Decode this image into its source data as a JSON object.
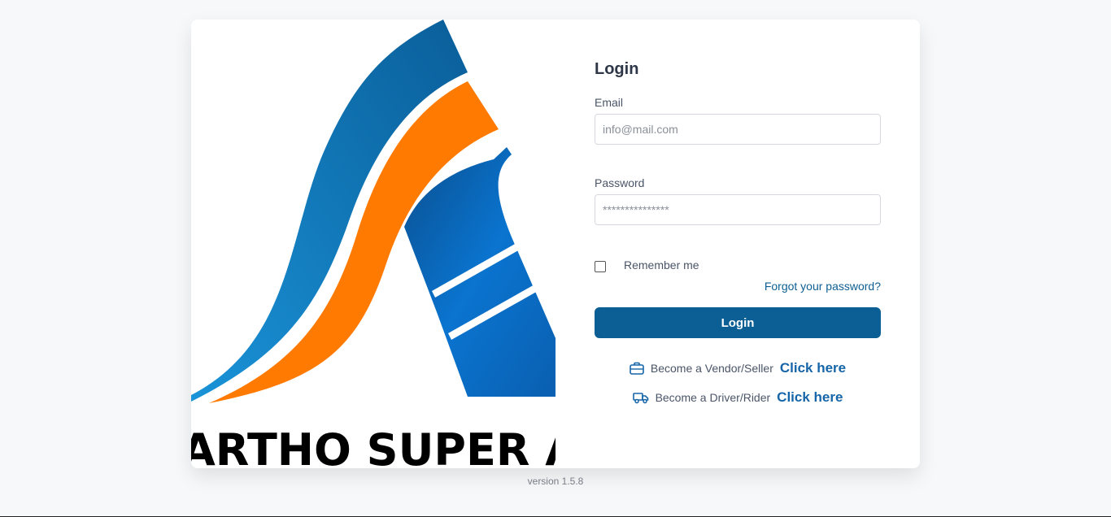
{
  "logo": {
    "wordmark": "ARTHO SUPER APP",
    "colors": {
      "blue_light": "#1485d0",
      "blue_dark": "#0a5a97",
      "orange": "#ff7a00"
    }
  },
  "login": {
    "title": "Login",
    "email": {
      "label": "Email",
      "placeholder": "info@mail.com",
      "value": ""
    },
    "password": {
      "label": "Password",
      "placeholder": "***************",
      "value": ""
    },
    "remember_label": "Remember me",
    "remember_checked": false,
    "forgot_label": "Forgot your password?",
    "submit_label": "Login"
  },
  "cta": [
    {
      "icon": "briefcase-icon",
      "text": "Become a Vendor/Seller",
      "link": "Click here"
    },
    {
      "icon": "truck-icon",
      "text": "Become a Driver/Rider",
      "link": "Click here"
    }
  ],
  "version": "version 1.5.8",
  "colors": {
    "accent": "#0c5f94",
    "link": "#1565a8",
    "background": "#f7f8fa"
  }
}
